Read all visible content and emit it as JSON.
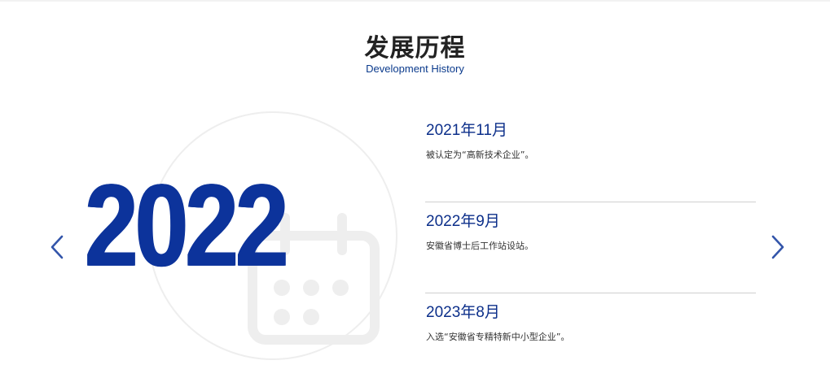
{
  "section": {
    "title": "发展历程",
    "subtitle": "Development History"
  },
  "current_year": "2022",
  "colors": {
    "brand_blue": "#0c339b",
    "heading_blue": "#0c2f8a",
    "arrow_blue": "#3355aa"
  },
  "icons": {
    "prev": "chevron-left-icon",
    "next": "chevron-right-icon",
    "background": "calendar-icon"
  },
  "timeline": [
    {
      "date": "2021年11月",
      "desc": "被认定为“高新技术企业”。"
    },
    {
      "date": "2022年9月",
      "desc": "安徽省博士后工作站设站。"
    },
    {
      "date": "2023年8月",
      "desc": "入选“安徽省专精特新中小型企业”。"
    }
  ]
}
